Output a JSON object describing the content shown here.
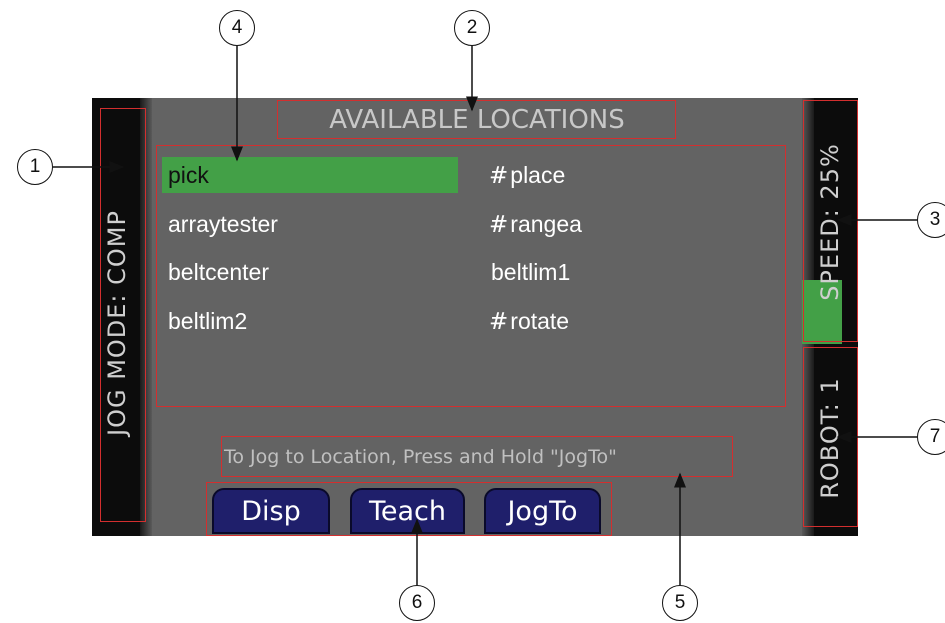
{
  "screen": {
    "title": "AVAILABLE LOCATIONS",
    "jog_mode": "JOG MODE: COMP",
    "speed": "SPEED: 25%",
    "speed_percent": 25,
    "robot": "ROBOT: 1",
    "hint": "To Jog to Location, Press and Hold \"JogTo\""
  },
  "locations": [
    {
      "hash": "",
      "name": "pick",
      "selected": true
    },
    {
      "hash": "#",
      "name": "place"
    },
    {
      "hash": "",
      "name": "arraytester"
    },
    {
      "hash": "#",
      "name": "rangea"
    },
    {
      "hash": "",
      "name": "beltcenter"
    },
    {
      "hash": "",
      "name": "beltlim1"
    },
    {
      "hash": "",
      "name": "beltlim2"
    },
    {
      "hash": "#",
      "name": "rotate"
    }
  ],
  "softkeys": [
    "Disp",
    "Teach",
    "JogTo"
  ],
  "callouts": [
    "1",
    "2",
    "3",
    "4",
    "5",
    "6",
    "7"
  ],
  "colors": {
    "selection": "#43a047",
    "softkey": "#1f1f6b",
    "annotation": "#d32f2f",
    "screen_bg": "#636363"
  }
}
